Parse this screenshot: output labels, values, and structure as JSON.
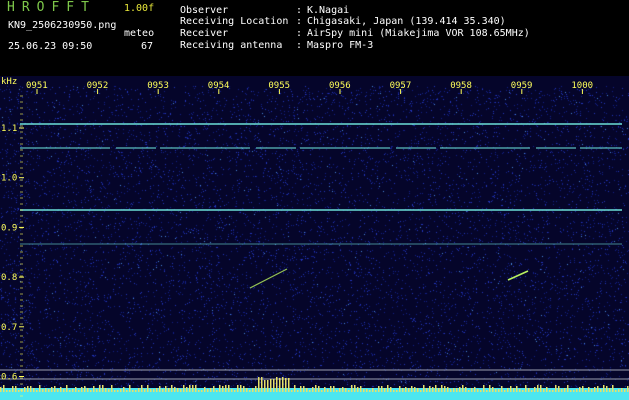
{
  "header": {
    "app_title": "HROFFT",
    "version": "1.00f",
    "filename": "KN9_2506230950.png",
    "mode": "meteo",
    "datetime": "25.06.23 09:50",
    "count": "67",
    "info": [
      {
        "label": "Observer",
        "value": "K.Nagai"
      },
      {
        "label": "Receiving Location",
        "value": "Chigasaki, Japan (139.414 35.340)"
      },
      {
        "label": "Receiver",
        "value": "AirSpy mini (Miakejima VOR 108.65MHz)"
      },
      {
        "label": "Receiving antenna",
        "value": "Maspro FM-3"
      }
    ]
  },
  "spectrogram": {
    "y_unit": "kHz",
    "y_ticks": [
      "1.1",
      "1.0",
      "0.9",
      "0.8",
      "0.7",
      "0.6"
    ],
    "x_ticks": [
      "0951",
      "0952",
      "0953",
      "0954",
      "0955",
      "0956",
      "0957",
      "0958",
      "0959",
      "1000"
    ],
    "colors": {
      "background": "#05052a",
      "noise": "#2438c0",
      "carrier": "#6ce0d8",
      "meteor": "#b8f060",
      "axis": "#ffff5a",
      "baseline": "#4de6f0"
    }
  }
}
